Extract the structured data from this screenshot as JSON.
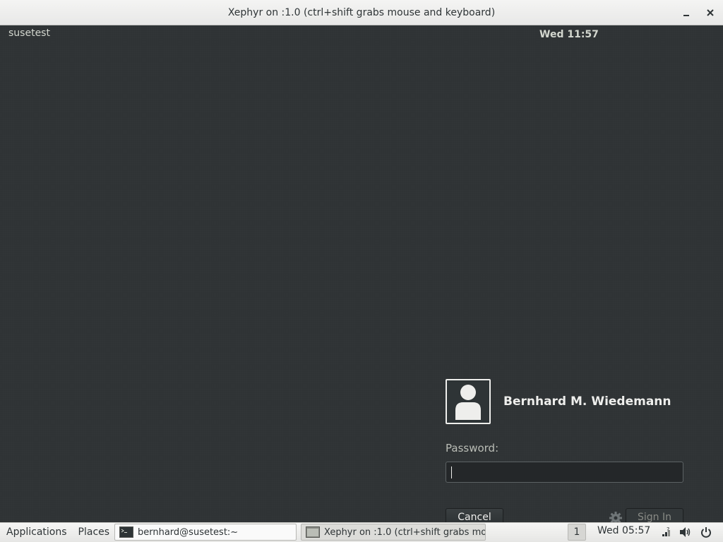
{
  "window": {
    "title": "Xephyr on :1.0 (ctrl+shift grabs mouse and keyboard)",
    "minimize_icon": "minimize-icon",
    "close_icon": "close-icon"
  },
  "gdm": {
    "hostname": "susetest",
    "clock": "Wed 11:57"
  },
  "login": {
    "user_name": "Bernhard M. Wiedemann",
    "avatar_icon": "user-avatar-icon",
    "password_label": "Password:",
    "password_value": "",
    "cancel_label": "Cancel",
    "settings_icon": "gear-icon",
    "signin_label": "Sign In"
  },
  "taskbar": {
    "applications_label": "Applications",
    "places_label": "Places",
    "tasks": [
      {
        "label": "bernhard@susetest:~",
        "icon": "terminal-icon"
      },
      {
        "label": "Xephyr on :1.0 (ctrl+shift grabs mo...",
        "icon": "window-icon"
      }
    ],
    "workspace": "1",
    "clock": "Wed 05:57",
    "tray_icons": [
      "network-icon",
      "volume-icon",
      "power-icon"
    ]
  },
  "colors": {
    "desktop_bg": "#2f3335",
    "text_light": "#eeeeec",
    "panel_bg": "#ededeb"
  }
}
